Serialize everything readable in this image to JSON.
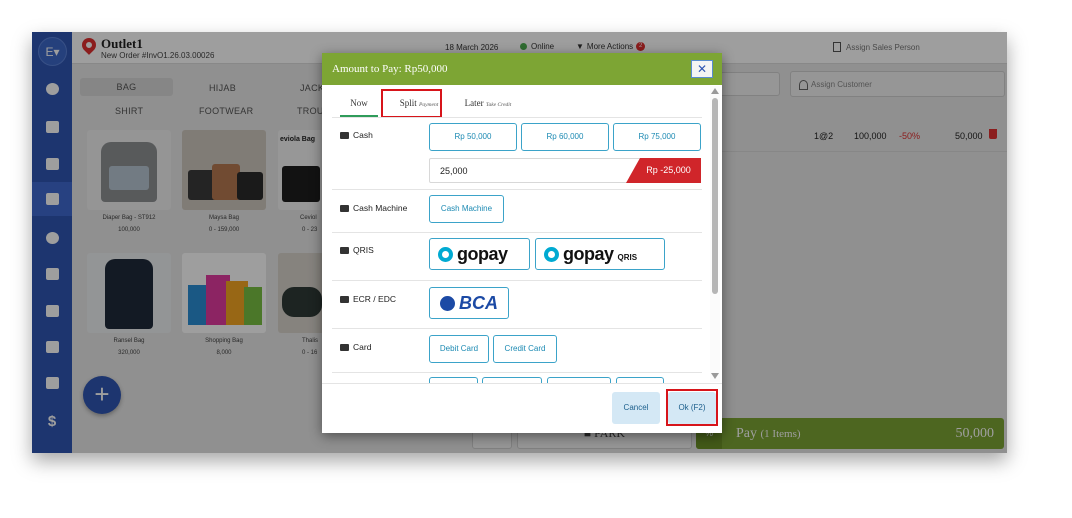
{
  "header": {
    "avatar_initial": "E",
    "outlet_name": "Outlet1",
    "order_number": "New Order #InvO1.26.03.00026",
    "date": "18 March 2026",
    "status": "Online",
    "more_actions": "More Actions",
    "more_actions_badge": "2",
    "assign_sales_person": "Assign Sales Person"
  },
  "categories": [
    "BAG",
    "HIJAB",
    "JACK",
    "SHIRT",
    "FOOTWEAR",
    "TROU"
  ],
  "products": [
    {
      "name": "Diaper Bag - ST912",
      "price": "100,000"
    },
    {
      "name": "Maysa Bag",
      "price": "0 - 159,000"
    },
    {
      "name": "Ceviol",
      "price": "0 - 23",
      "label": "eviola Bag"
    },
    {
      "name": "Ransel Bag",
      "price": "320,000"
    },
    {
      "name": "Shopping Bag",
      "price": "8,000"
    },
    {
      "name": "Thalis",
      "price": "0 - 16"
    }
  ],
  "right_panel": {
    "assign_customer": "Assign Customer",
    "cart_item": {
      "qty": "1@2",
      "price": "100,000",
      "discount": "-50%",
      "total": "50,000"
    }
  },
  "bottom": {
    "park_label": "PARK",
    "pay_label": "Pay",
    "pay_items": "(1 Items)",
    "pay_amount": "50,000"
  },
  "modal": {
    "title": "Amount to Pay: Rp50,000",
    "close": "✕",
    "tabs": [
      {
        "label": "Now",
        "sub": ""
      },
      {
        "label": "Split",
        "sub": "Payment"
      },
      {
        "label": "Later",
        "sub": "Take Credit"
      }
    ],
    "cash": {
      "label": "Cash",
      "quick_amounts": [
        "Rp 50,000",
        "Rp 60,000",
        "Rp 75,000"
      ],
      "input_value": "25,000",
      "change": "Rp -25,000"
    },
    "cash_machine": {
      "label": "Cash Machine",
      "button": "Cash Machine"
    },
    "qris": {
      "label": "QRIS",
      "options": [
        "gopay",
        "gopay"
      ],
      "qris_suffix": "QRIS"
    },
    "ecr": {
      "label": "ECR / EDC",
      "option": "BCA"
    },
    "card": {
      "label": "Card",
      "options": [
        "Debit Card",
        "Credit Card"
      ]
    },
    "cancel": "Cancel",
    "ok": "Ok (F2)"
  },
  "colors": {
    "brand_blue": "#2f56b3",
    "header_green": "#7da534",
    "alert_red": "#d0252a",
    "outline_blue": "#3ba3c9"
  }
}
